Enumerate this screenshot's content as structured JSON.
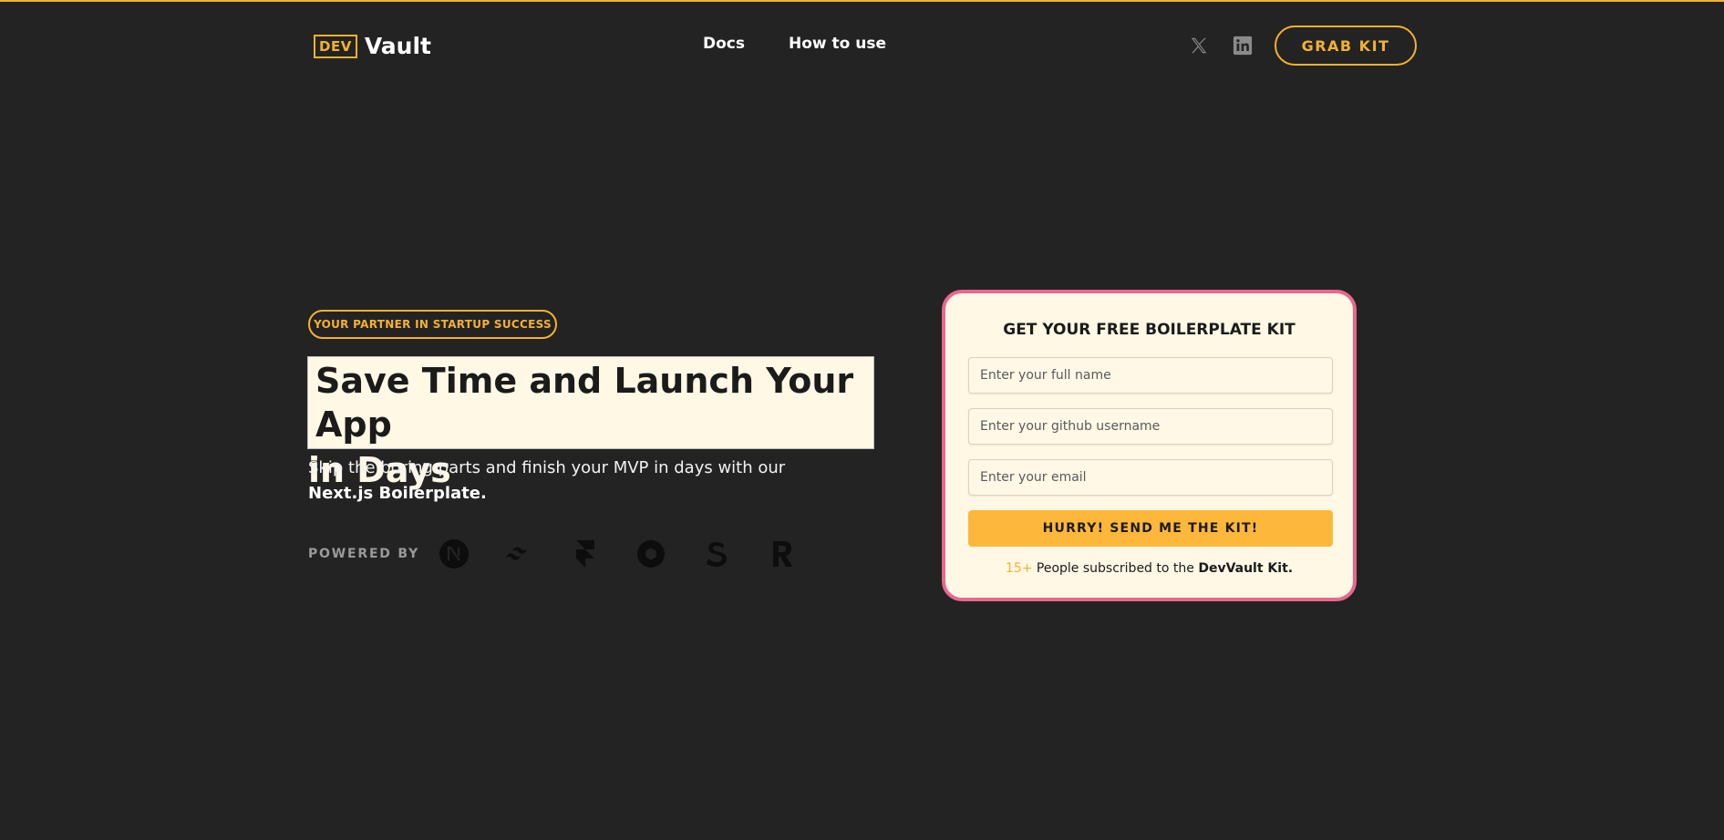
{
  "header": {
    "logo_box": "DEV",
    "logo_text": "Vault",
    "nav": [
      {
        "label": "Docs"
      },
      {
        "label": "How to use"
      }
    ],
    "social_icons": [
      "x-twitter-icon",
      "linkedin-icon"
    ],
    "cta_label": "GRAB KIT"
  },
  "hero": {
    "badge": "YOUR PARTNER IN STARTUP SUCCESS",
    "headline_line1": "Save Time and Launch Your App",
    "headline_line2": "in Days",
    "subtitle_text": "Skip the boring parts and finish your MVP in days with our ",
    "subtitle_bold": "Next.js Boilerplate.",
    "powered_by_label": "POWERED BY",
    "tech_icons": [
      "nextjs-icon",
      "tailwind-icon",
      "framer-icon",
      "openai-icon",
      "stripe-icon",
      "resend-icon"
    ]
  },
  "form": {
    "title": "GET YOUR FREE BOILERPLATE KIT",
    "name_placeholder": "Enter your full name",
    "github_placeholder": "Enter your github username",
    "email_placeholder": "Enter your email",
    "submit_label": "HURRY! SEND ME THE KIT!",
    "subscriber_count": "15+",
    "subscriber_text": " People subscribed to the ",
    "subscriber_brand": "DevVault Kit."
  },
  "colors": {
    "background": "#232323",
    "accent": "#f5b12e",
    "card_bg": "#fff8e4",
    "card_border": "#e8688d",
    "button_bg": "#fdb73b"
  }
}
